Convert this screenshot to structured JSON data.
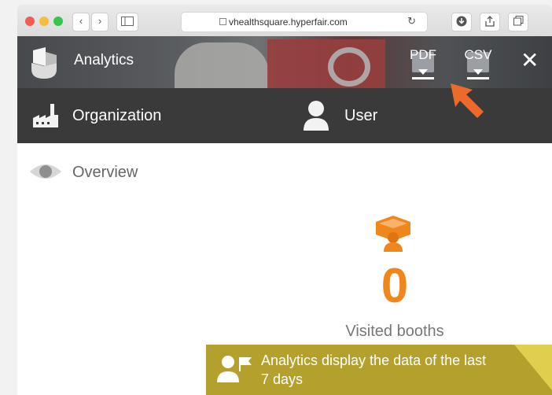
{
  "browser": {
    "url": "vhealthsquare.hyperfair.com",
    "back_glyph": "‹",
    "forward_glyph": "›"
  },
  "header": {
    "title": "Analytics",
    "export_pdf": "PDF",
    "export_csv": "CSV",
    "close_glyph": "✕"
  },
  "tabs": {
    "organization": "Organization",
    "user": "User"
  },
  "overview": {
    "label": "Overview"
  },
  "stats": {
    "visited_booths_value": "0",
    "visited_booths_label": "Visited booths"
  },
  "notice": {
    "text": "Analytics display the data of the last 7 days"
  },
  "colors": {
    "accent_orange": "#f0871d",
    "tab_bar": "#3a3a3a",
    "notice_bg": "#b4a12d"
  }
}
